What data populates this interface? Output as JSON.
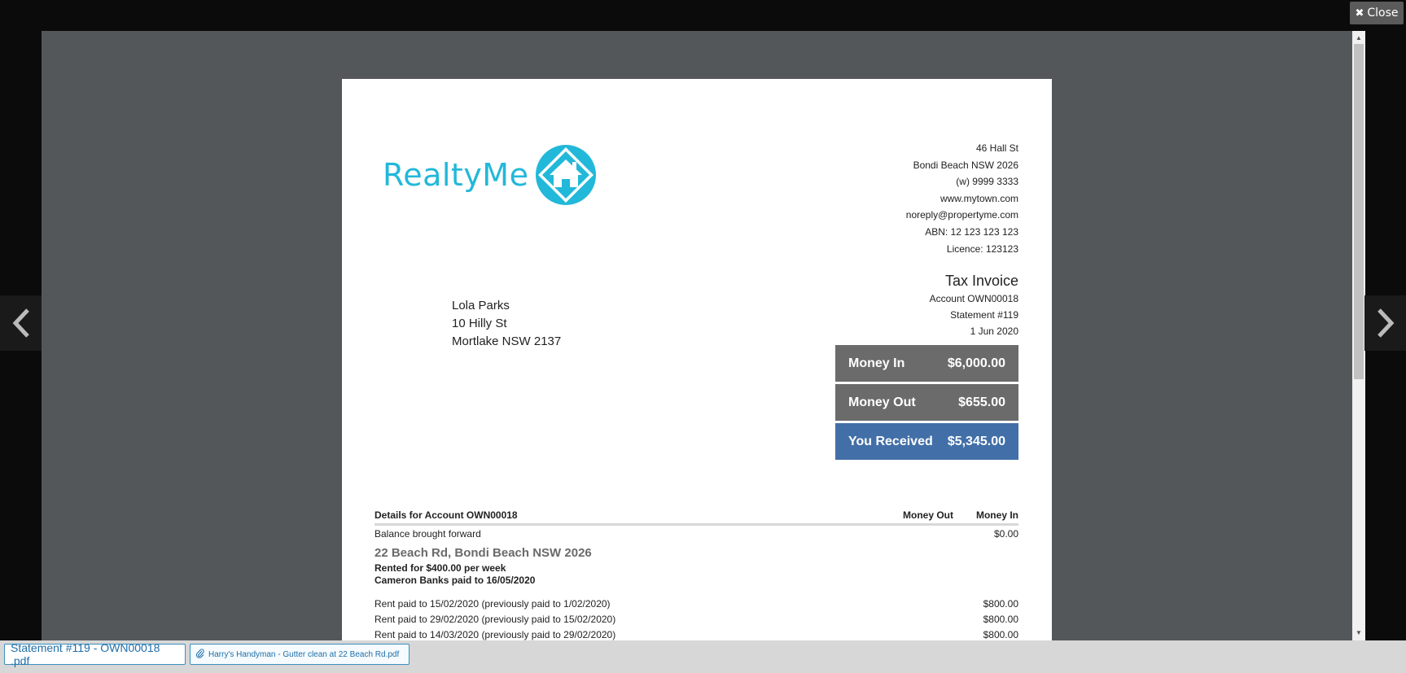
{
  "viewer": {
    "close_label": "Close"
  },
  "agency": {
    "logo_text": "RealtyMe",
    "address_lines": [
      "46 Hall St",
      "Bondi Beach NSW 2026",
      "(w) 9999 3333",
      "www.mytown.com",
      "noreply@propertyme.com",
      "ABN: 12 123 123 123",
      "Licence: 123123"
    ]
  },
  "invoice": {
    "title": "Tax Invoice",
    "account": "Account OWN00018",
    "statement": "Statement #119",
    "date": "1 Jun 2020"
  },
  "recipient": {
    "lines": [
      "Lola Parks",
      "10 Hilly St",
      "Mortlake NSW 2137"
    ]
  },
  "summary": [
    {
      "label": "Money In",
      "value": "$6,000.00",
      "color": "#6b6b6b"
    },
    {
      "label": "Money Out",
      "value": "$655.00",
      "color": "#6b6b6b"
    },
    {
      "label": "You Received",
      "value": "$5,345.00",
      "color": "#426fa8"
    }
  ],
  "details": {
    "header": "Details for Account OWN00018",
    "col_out": "Money Out",
    "col_in": "Money In",
    "balance": {
      "label": "Balance brought forward",
      "in": "$0.00"
    },
    "property": {
      "address": "22 Beach Rd, Bondi Beach NSW 2026",
      "rent": "Rented for $400.00 per week",
      "tenant": "Cameron Banks paid to 16/05/2020"
    },
    "rows": [
      {
        "label": "Rent paid to 15/02/2020 (previously paid to 1/02/2020)",
        "in": "$800.00"
      },
      {
        "label": "Rent paid to 29/02/2020 (previously paid to 15/02/2020)",
        "in": "$800.00"
      },
      {
        "label": "Rent paid to 14/03/2020 (previously paid to 29/02/2020)",
        "in": "$800.00"
      }
    ]
  },
  "attachments": [
    {
      "label": "Statement #119 - OWN00018 .pdf",
      "active": true
    },
    {
      "label": "Harry's Handyman - Gutter clean at 22 Beach Rd.pdf",
      "active": false
    }
  ]
}
